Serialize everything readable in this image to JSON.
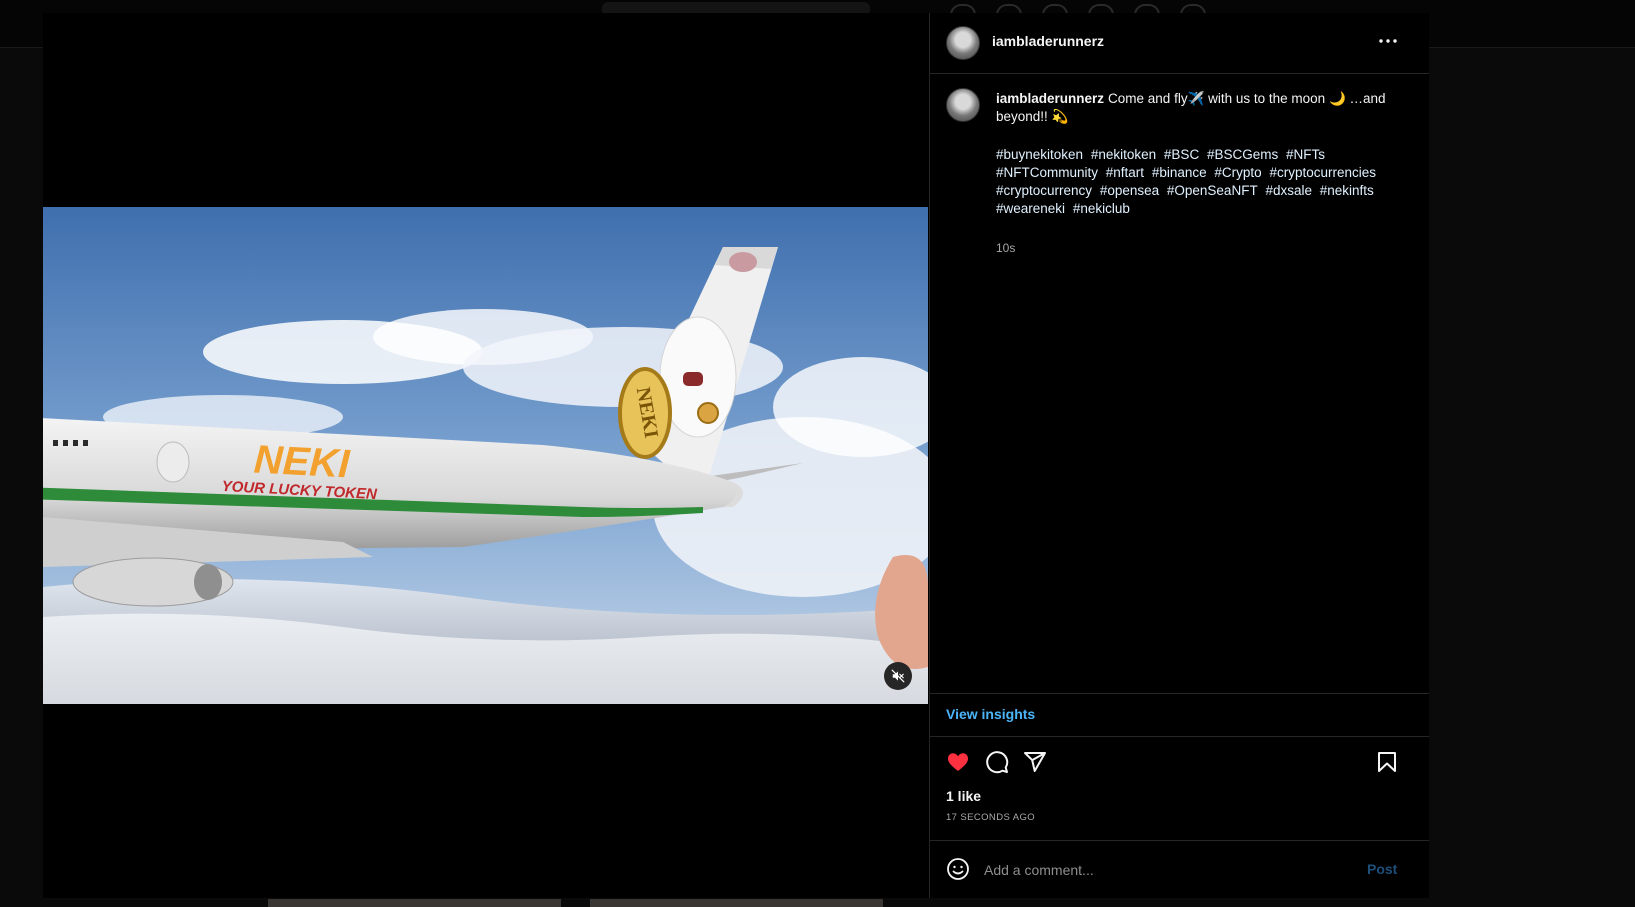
{
  "post": {
    "username": "iambladerunnerz",
    "caption_text": "Come and fly✈️ with us to the moon 🌙 …and beyond!! 💫",
    "hashtags": [
      "#buynekitoken",
      "#nekitoken",
      "#BSC",
      "#BSCGems",
      "#NFTs",
      "#NFTCommunity",
      "#nftart",
      "#binance",
      "#Crypto",
      "#cryptocurrencies",
      "#cryptocurrency",
      "#opensea",
      "#OpenSeaNFT",
      "#dxsale",
      "#nekinfts",
      "#weareneki",
      "#nekiclub"
    ],
    "caption_age": "10s",
    "insights_label": "View insights",
    "likes_label": "1 like",
    "posted_ago": "17 SECONDS AGO",
    "liked": true
  },
  "video": {
    "livery_title": "NEKI",
    "livery_subtitle": "YOUR LUCKY TOKEN",
    "coin_text": "NEKI",
    "muted": true
  },
  "comment": {
    "placeholder": "Add a comment...",
    "post_label": "Post"
  },
  "icons": {
    "like": "heart-icon",
    "comment": "comment-icon",
    "share": "paper-plane-icon",
    "save": "bookmark-icon",
    "emoji": "smiley-icon",
    "mute": "speaker-muted-icon",
    "more": "more-horizontal-icon"
  },
  "colors": {
    "like_red": "#ff3040",
    "link_blue": "#4cb5f9",
    "hashtag": "#e0f1ff",
    "neki_orange": "#f2a12e",
    "livery_red": "#c0282b",
    "livery_green": "#2e8b3a"
  }
}
